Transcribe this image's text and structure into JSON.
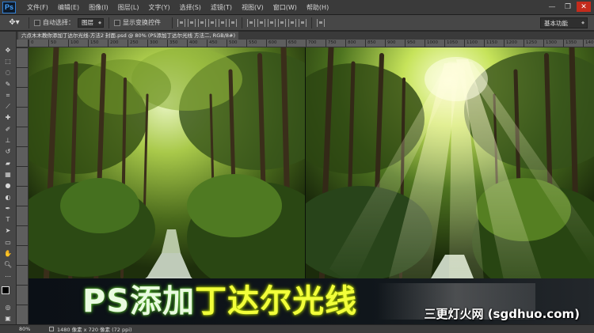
{
  "menubar": {
    "app_icon": "Ps",
    "items": [
      "文件(F)",
      "编辑(E)",
      "图像(I)",
      "图层(L)",
      "文字(Y)",
      "选择(S)",
      "滤镜(T)",
      "视图(V)",
      "窗口(W)",
      "帮助(H)"
    ],
    "window_controls": [
      "minimize-icon",
      "restore-icon",
      "close-icon"
    ]
  },
  "options": {
    "auto_select_label": "自动选择：",
    "auto_select_value": "图层",
    "show_transform_label": "显示变换控件",
    "workspace_value": "基本功能"
  },
  "document": {
    "tab_title": "六点木木教你添加丁达尔光线-方法2 封面.psd @ 80% (PS添加丁达尔光线 方法二, RGB/8#)"
  },
  "ruler": {
    "top_ticks": [
      "0",
      "50",
      "100",
      "150",
      "200",
      "250",
      "300",
      "350",
      "400",
      "450",
      "500",
      "550",
      "600",
      "650",
      "700",
      "750",
      "800",
      "850",
      "900",
      "950",
      "1000",
      "1050",
      "1100",
      "1150",
      "1200",
      "1250",
      "1300",
      "1350",
      "1400",
      "1450"
    ]
  },
  "banner": {
    "part_white": "PS添加",
    "part_yellow": "丁达尔光线",
    "watermark": "三更灯火网 (sgdhuo.com)"
  },
  "status": {
    "zoom": "80%",
    "doc_info": "1480 像素 x 720 像素 (72 ppi)"
  },
  "colors": {
    "accent_blue": "#2f7fd6",
    "title_white": "#e9fbe0",
    "title_yellow": "#f2ff3a"
  }
}
